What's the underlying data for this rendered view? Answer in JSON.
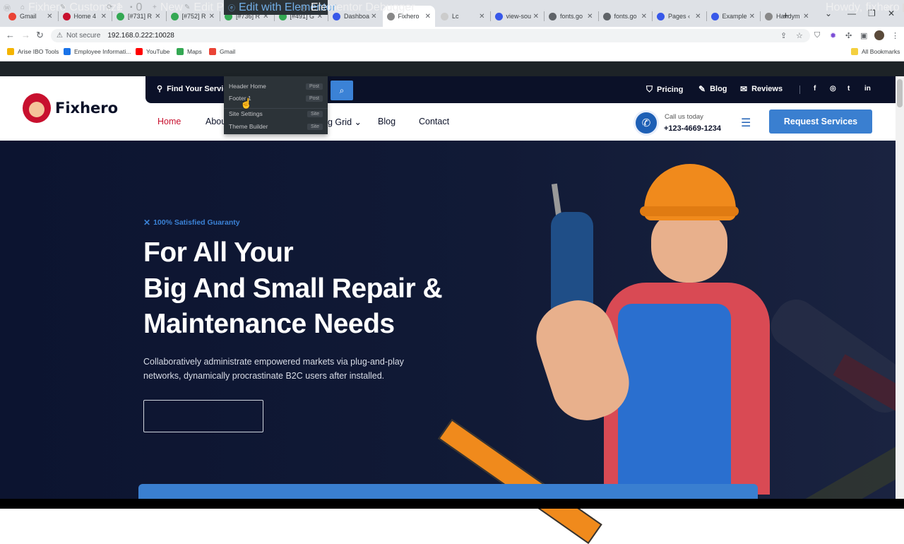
{
  "browser": {
    "tabs": [
      {
        "label": "Gmail",
        "icon": "gmail-icon",
        "color": "#ea4335"
      },
      {
        "label": "Home 4",
        "icon": "shield-icon",
        "color": "#c8102e"
      },
      {
        "label": "[#731] R",
        "icon": "g-icon",
        "color": "#34a853"
      },
      {
        "label": "[#752] R",
        "icon": "g-icon",
        "color": "#34a853"
      },
      {
        "label": "[#736] R",
        "icon": "g-icon",
        "color": "#34a853"
      },
      {
        "label": "[#491] G",
        "icon": "g-icon",
        "color": "#34a853"
      },
      {
        "label": "Dashboa",
        "icon": "wordpress-icon",
        "color": "#3858e9"
      },
      {
        "label": "Fixhero",
        "icon": "site-icon",
        "color": "#888888"
      },
      {
        "label": "Lc",
        "icon": "blank-icon",
        "color": "#cccccc"
      },
      {
        "label": "view-sou",
        "icon": "wordpress-icon",
        "color": "#3858e9"
      },
      {
        "label": "fonts.go",
        "icon": "globe-icon",
        "color": "#5f6368"
      },
      {
        "label": "fonts.go",
        "icon": "globe-icon",
        "color": "#5f6368"
      },
      {
        "label": "Pages ‹",
        "icon": "wordpress-icon",
        "color": "#3858e9"
      },
      {
        "label": "Example",
        "icon": "wordpress-icon",
        "color": "#3858e9"
      },
      {
        "label": "Handym",
        "icon": "site-icon",
        "color": "#888888"
      }
    ],
    "active_tab_index": 7,
    "security_label": "Not secure",
    "url": "192.168.0.222:10028",
    "bookmarks": [
      {
        "label": "Arise IBO Tools",
        "color": "#f4b400"
      },
      {
        "label": "Employee Informati...",
        "color": "#1a73e8"
      },
      {
        "label": "YouTube",
        "color": "#ff0000"
      },
      {
        "label": "Maps",
        "color": "#34a853"
      },
      {
        "label": "Gmail",
        "color": "#ea4335"
      }
    ],
    "all_bookmarks": "All Bookmarks"
  },
  "adminbar": {
    "site": "Fixhero",
    "customize": "Customize",
    "updates": "1",
    "comments": "0",
    "new": "New",
    "edit_page": "Edit Page",
    "edit_elementor": "Edit with Elementor",
    "debugger": "Elementor Debugger",
    "howdy": "Howdy, fixhero"
  },
  "dropdown": {
    "items": [
      {
        "label": "Header Home",
        "tag": "Post"
      },
      {
        "label": "Footer 1",
        "tag": "Post"
      },
      {
        "label": "Site Settings",
        "tag": "Site"
      },
      {
        "label": "Theme Builder",
        "tag": "Site"
      }
    ]
  },
  "site": {
    "logo": "Fixhero",
    "search_label": "Find Your Servic",
    "top_links": [
      "Pricing",
      "Blog",
      "Reviews"
    ],
    "social": [
      "f",
      "◎",
      "t",
      "in"
    ],
    "menu": [
      "Home",
      "Abou",
      "g Grid ⌄",
      "Blog",
      "Contact"
    ],
    "call_label": "Call us today",
    "call_number": "+123-4669-1234",
    "request_button": "Request Services",
    "accent": "#3a7fd0",
    "brand_red": "#c8102e"
  },
  "hero": {
    "guaranty": "100% Satisfied Guaranty",
    "heading_lines": [
      "For All Your",
      "Big And Small Repair &",
      "Maintenance Needs"
    ],
    "subtext": "Collaboratively administrate empowered markets via plug-and-play networks, dynamically procrastinate B2C users after installed."
  }
}
